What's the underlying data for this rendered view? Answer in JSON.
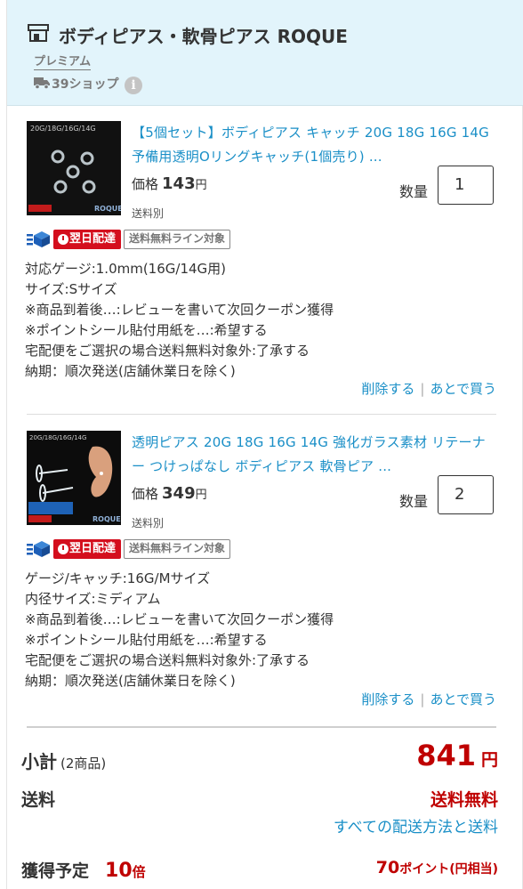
{
  "shop": {
    "name": "ボディピアス・軟骨ピアス ROQUE",
    "tier": "プレミアム",
    "ship_count": "39ショップ",
    "info_glyph": "i",
    "icons": [
      "store-icon",
      "truck-icon",
      "info-icon"
    ]
  },
  "items": [
    {
      "title": "【5個セット】ボディピアス キャッチ 20G 18G 16G 14G 予備用透明Oリングキャッチ(1個売り) ...",
      "thumb_caption": "20G/18G/16G/14G",
      "thumb_logo": "ROQUE",
      "price_label": "価格",
      "price": "143",
      "price_unit": "円",
      "shipping_note": "送料別",
      "qty_label": "数量",
      "qty": "1",
      "badge_nextday": "翌日配達",
      "badge_freeline": "送料無料ライン対象",
      "options": [
        "対応ゲージ:1.0mm(16G/14G用)",
        "サイズ:Sサイズ",
        "※商品到着後…:レビューを書いて次回クーポン獲得",
        "※ポイントシール貼付用紙を…:希望する",
        "宅配便をご選択の場合送料無料対象外:了承する",
        "納期：順次発送(店舗休業日を除く)"
      ],
      "action_delete": "削除する",
      "action_later": "あとで買う"
    },
    {
      "title": "透明ピアス 20G 18G 16G 14G 強化ガラス素材 リテーナー つけっぱなし ボディピアス 軟骨ピア ...",
      "thumb_caption": "20G/18G/16G/14G",
      "thumb_logo": "ROQUE",
      "price_label": "価格",
      "price": "349",
      "price_unit": "円",
      "shipping_note": "送料別",
      "qty_label": "数量",
      "qty": "2",
      "badge_nextday": "翌日配達",
      "badge_freeline": "送料無料ライン対象",
      "options": [
        "ゲージ/キャッチ:16G/Mサイズ",
        "内径サイズ:ミディアム",
        "※商品到着後…:レビューを書いて次回クーポン獲得",
        "※ポイントシール貼付用紙を…:希望する",
        "宅配便をご選択の場合送料無料対象外:了承する",
        "納期：順次発送(店舗休業日を除く)"
      ],
      "action_delete": "削除する",
      "action_later": "あとで買う"
    }
  ],
  "summary": {
    "subtotal_label": "小計",
    "subtotal_count": "(2商品)",
    "subtotal_value": "841",
    "subtotal_unit": "円",
    "shipping_label": "送料",
    "shipping_value": "送料無料",
    "shipping_link": "すべての配送方法と送料",
    "points_label": "獲得予定",
    "points_multiplier": "10",
    "points_multiplier_unit": "倍",
    "points_value": "70",
    "points_unit": "ポイント",
    "points_note": "(円相当)"
  },
  "colors": {
    "link": "#1a8fc7",
    "price_red": "#bf0000",
    "badge_red": "#d40e1d",
    "header_bg": "#e2f4fb",
    "cube_blue": "#1d5fb8"
  }
}
